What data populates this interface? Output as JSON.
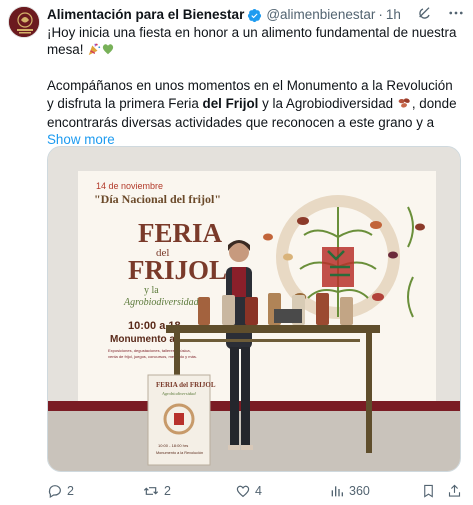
{
  "post": {
    "display_name": "Alimentación para el Bienestar",
    "handle": "@alimenbienestar",
    "separator": "·",
    "time": "1h",
    "line1": "¡Hoy inicia una fiesta en honor a un alimento fundamental de nuestra mesa!",
    "p2_a": "Acompáñanos en unos momentos en el Monumento a la Revolución y disfruta la primera Feria",
    "p2_bold": "del Frijol",
    "p2_b": "y la Agrobiodiversidad",
    "p2_c": ", donde encontrarás diversas actividades que reconocen a este grano y a",
    "show_more": "Show more"
  },
  "media": {
    "banner_date": "14 de noviembre",
    "banner_subtitle": "\"Día Nacional del frijol\"",
    "title_feria": "FERIA",
    "title_del": "del",
    "title_frijol": "FRIJOL",
    "title_y": "y la",
    "title_agro": "Agrobiodiversidad",
    "time_text": "10:00 a 18",
    "place_text": "Monumento a",
    "small_text_1": "Exposiciones, degustaciones, talleres, música,",
    "small_text_2": "venta de frijol, juegos, concursos, mercado y más.",
    "poster_feria": "FERIA del FRIJOL",
    "poster_agro": "Agrobiodiversidad",
    "poster_time": "10:00 - 18:00 hrs",
    "poster_place": "Monumento a la Revolución"
  },
  "metrics": {
    "replies": "2",
    "reposts": "2",
    "likes": "4",
    "views": "360"
  },
  "colors": {
    "brand": "#7a1c24",
    "link": "#1d9bf0",
    "muted": "#536471",
    "verified": "#1d9bf0"
  }
}
